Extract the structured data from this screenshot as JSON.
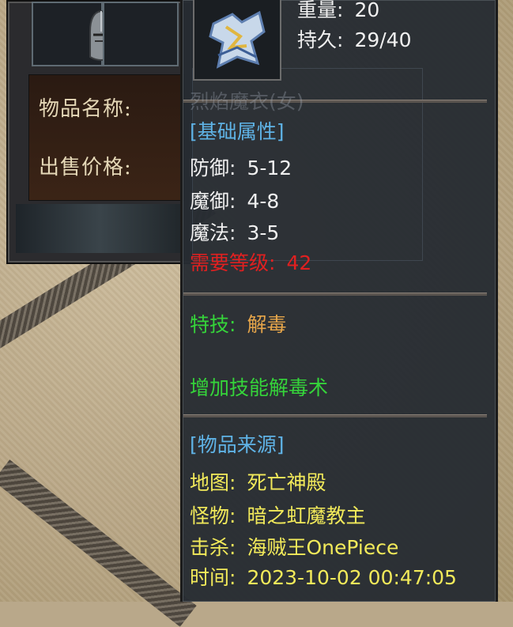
{
  "store": {
    "name_label": "物品名称:",
    "price_label": "出售价格:"
  },
  "tooltip": {
    "weight_label": "重量:",
    "weight_value": "20",
    "durability_label": "持久:",
    "durability_value": "29/40",
    "item_name_ghost": "烈焰魔衣(女)",
    "basic_header": "[基础属性]",
    "stats": [
      {
        "label": "防御:",
        "value": "5-12"
      },
      {
        "label": "魔御:",
        "value": "4-8"
      },
      {
        "label": "魔法:",
        "value": "3-5"
      }
    ],
    "req_label": "需要等级:",
    "req_value": "42",
    "skill_label": "特技:",
    "skill_value": "解毒",
    "skill_desc": "增加技能解毒术",
    "source_header": "[物品来源]",
    "source": [
      {
        "label": "地图:",
        "value": "死亡神殿"
      },
      {
        "label": "怪物:",
        "value": "暗之虹魔教主"
      },
      {
        "label": "击杀:",
        "value": "海贼王OnePiece"
      },
      {
        "label": "时间:",
        "value": "2023-10-02 00:47:05"
      }
    ]
  },
  "colors": {
    "header_blue": "#5fb3e6",
    "skill_green": "#35d43a",
    "skill_orange": "#e5a54a",
    "source_yellow": "#f2ea5a",
    "requirement_red": "#e02020"
  }
}
